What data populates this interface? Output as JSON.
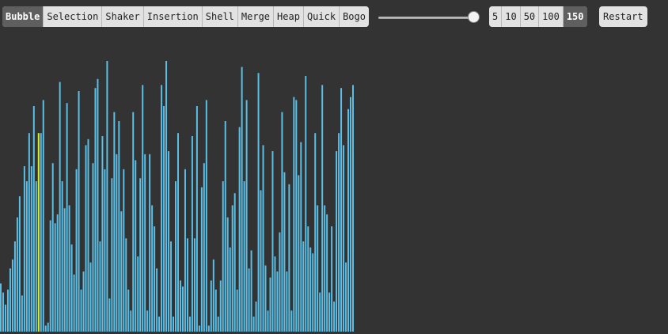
{
  "algorithms": [
    {
      "label": "Bubble",
      "active": true
    },
    {
      "label": "Selection",
      "active": false
    },
    {
      "label": "Shaker",
      "active": false
    },
    {
      "label": "Insertion",
      "active": false
    },
    {
      "label": "Shell",
      "active": false
    },
    {
      "label": "Merge",
      "active": false
    },
    {
      "label": "Heap",
      "active": false
    },
    {
      "label": "Quick",
      "active": false
    },
    {
      "label": "Bogo",
      "active": false
    }
  ],
  "speed_slider": {
    "value_fraction": 1.0
  },
  "sizes": [
    {
      "label": "5",
      "active": false
    },
    {
      "label": "10",
      "active": false
    },
    {
      "label": "50",
      "active": false
    },
    {
      "label": "100",
      "active": false
    },
    {
      "label": "150",
      "active": true
    }
  ],
  "restart_label": "Restart",
  "colors": {
    "bar": "#5bbfe6",
    "highlight": "#d8ef2b",
    "background": "#333333"
  },
  "bars": {
    "highlighted_indices": [
      16
    ],
    "values": [
      0.16,
      0.13,
      0.09,
      0.14,
      0.21,
      0.24,
      0.3,
      0.38,
      0.45,
      0.12,
      0.55,
      0.5,
      0.66,
      0.55,
      0.75,
      0.5,
      0.66,
      0.66,
      0.77,
      0.02,
      0.03,
      0.37,
      0.56,
      0.36,
      0.39,
      0.83,
      0.5,
      0.41,
      0.76,
      0.42,
      0.29,
      0.19,
      0.54,
      0.8,
      0.14,
      0.2,
      0.62,
      0.64,
      0.23,
      0.56,
      0.81,
      0.84,
      0.3,
      0.65,
      0.54,
      0.9,
      0.11,
      0.51,
      0.73,
      0.59,
      0.7,
      0.4,
      0.54,
      0.31,
      0.14,
      0.07,
      0.73,
      0.57,
      0.25,
      0.51,
      0.82,
      0.59,
      0.07,
      0.59,
      0.42,
      0.35,
      0.21,
      0.05,
      0.82,
      0.75,
      0.9,
      0.6,
      0.3,
      0.05,
      0.5,
      0.66,
      0.17,
      0.15,
      0.54,
      0.31,
      0.05,
      0.65,
      0.31,
      0.75,
      0.02,
      0.48,
      0.56,
      0.77,
      0.02,
      0.17,
      0.24,
      0.14,
      0.05,
      0.17,
      0.5,
      0.7,
      0.38,
      0.28,
      0.42,
      0.46,
      0.14,
      0.68,
      0.88,
      0.5,
      0.77,
      0.21,
      0.27,
      0.05,
      0.1,
      0.86,
      0.47,
      0.62,
      0.22,
      0.07,
      0.18,
      0.6,
      0.25,
      0.2,
      0.33,
      0.73,
      0.53,
      0.2,
      0.49,
      0.07,
      0.78,
      0.77,
      0.52,
      0.63,
      0.3,
      0.85,
      0.35,
      0.28,
      0.26,
      0.66,
      0.42,
      0.13,
      0.82,
      0.42,
      0.39,
      0.13,
      0.35,
      0.1,
      0.6,
      0.66,
      0.81,
      0.62,
      0.23,
      0.74,
      0.78,
      0.82
    ]
  }
}
